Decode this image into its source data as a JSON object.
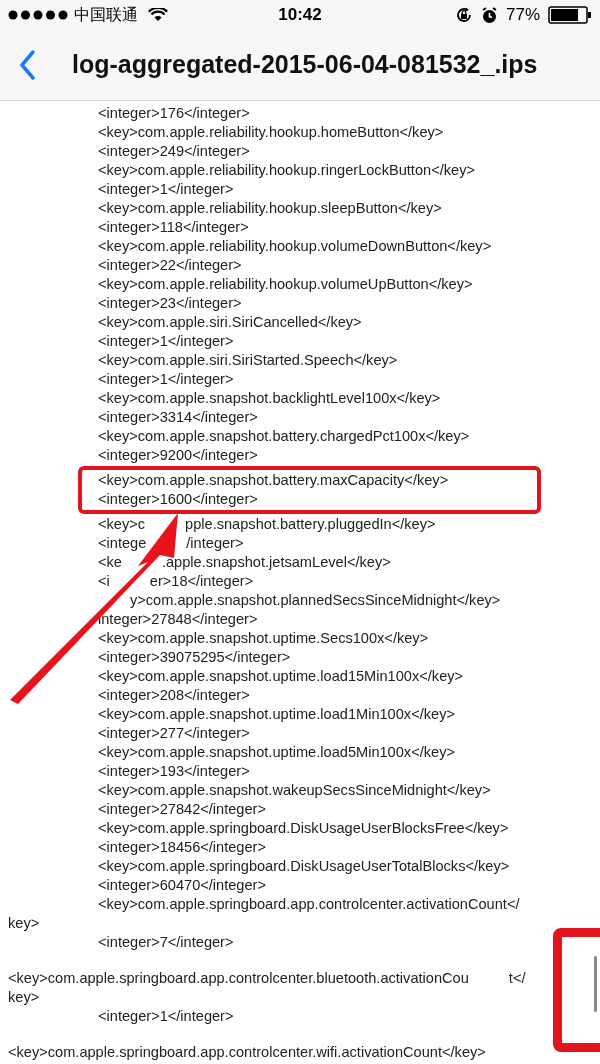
{
  "status_bar": {
    "carrier": "中国联通",
    "time": "10:42",
    "battery": "77%"
  },
  "nav": {
    "title": "log-aggregated-2015-06-04-081532_.ips"
  },
  "lines": [
    {
      "kind": "indented",
      "parts": [
        "<integer>176</integer>"
      ]
    },
    {
      "kind": "indented",
      "parts": [
        "<key>com.apple.reliability.hookup.homeButton</key>"
      ]
    },
    {
      "kind": "indented",
      "parts": [
        "<integer>249</integer>"
      ]
    },
    {
      "kind": "indented",
      "parts": [
        "<key>com.apple.reliability.hookup.ringerLockButton</key>"
      ]
    },
    {
      "kind": "indented",
      "parts": [
        "<integer>1</integer>"
      ]
    },
    {
      "kind": "indented",
      "parts": [
        "<key>com.apple.reliability.hookup.sleepButton</key>"
      ]
    },
    {
      "kind": "indented",
      "parts": [
        "<integer>118</integer>"
      ]
    },
    {
      "kind": "indented",
      "parts": [
        "<key>com.apple.reliability.hookup.volumeDownButton</key>"
      ]
    },
    {
      "kind": "indented",
      "parts": [
        "<integer>22</integer>"
      ]
    },
    {
      "kind": "indented",
      "parts": [
        "<key>com.apple.reliability.hookup.volumeUpButton</key>"
      ]
    },
    {
      "kind": "indented",
      "parts": [
        "<integer>23</integer>"
      ]
    },
    {
      "kind": "indented",
      "parts": [
        "<key>com.apple.siri.SiriCancelled</key>"
      ]
    },
    {
      "kind": "indented",
      "parts": [
        "<integer>1</integer>"
      ]
    },
    {
      "kind": "indented",
      "parts": [
        "<key>com.apple.siri.SiriStarted.Speech</key>"
      ]
    },
    {
      "kind": "indented",
      "parts": [
        "<integer>1</integer>"
      ]
    },
    {
      "kind": "indented",
      "parts": [
        "<key>com.apple.snapshot.backlightLevel100x</key>"
      ]
    },
    {
      "kind": "indented",
      "parts": [
        "<integer>3314</integer>"
      ]
    },
    {
      "kind": "indented",
      "parts": [
        "<key>com.apple.snapshot.battery.chargedPct100x</key>"
      ]
    },
    {
      "kind": "indented",
      "parts": [
        "<integer>9200</integer>"
      ]
    },
    {
      "kind": "highlighted",
      "parts": [
        "<key>com.apple.snapshot.battery.maxCapacity</key>"
      ]
    },
    {
      "kind": "highlighted",
      "parts": [
        "<integer>1600</integer>"
      ]
    },
    {
      "kind": "indented",
      "parts": [
        "<key>c",
        "pple.snapshot.battery.pluggedIn</key>"
      ]
    },
    {
      "kind": "indented",
      "parts": [
        "<intege",
        "/integer>"
      ]
    },
    {
      "kind": "indented",
      "parts": [
        "<ke",
        ".apple.snapshot.jetsamLevel</key>"
      ]
    },
    {
      "kind": "indented",
      "parts": [
        "<i",
        "er>18</integer>"
      ]
    },
    {
      "kind": "covered",
      "parts": [
        "y>com.apple.snapshot.plannedSecsSinceMidnight</key>"
      ]
    },
    {
      "kind": "indented",
      "parts": [
        "integer>27848</integer>"
      ]
    },
    {
      "kind": "indented",
      "parts": [
        "<key>com.apple.snapshot.uptime.Secs100x</key>"
      ]
    },
    {
      "kind": "indented",
      "parts": [
        "<integer>39075295</integer>"
      ]
    },
    {
      "kind": "indented",
      "parts": [
        "<key>com.apple.snapshot.uptime.load15Min100x</key>"
      ]
    },
    {
      "kind": "indented",
      "parts": [
        "<integer>208</integer>"
      ]
    },
    {
      "kind": "indented",
      "parts": [
        "<key>com.apple.snapshot.uptime.load1Min100x</key>"
      ]
    },
    {
      "kind": "indented",
      "parts": [
        "<integer>277</integer>"
      ]
    },
    {
      "kind": "indented",
      "parts": [
        "<key>com.apple.snapshot.uptime.load5Min100x</key>"
      ]
    },
    {
      "kind": "indented",
      "parts": [
        "<integer>193</integer>"
      ]
    },
    {
      "kind": "indented",
      "parts": [
        "<key>com.apple.snapshot.wakeupSecsSinceMidnight</key>"
      ]
    },
    {
      "kind": "indented",
      "parts": [
        "<integer>27842</integer>"
      ]
    },
    {
      "kind": "indented",
      "parts": [
        "<key>com.apple.springboard.DiskUsageUserBlocksFree</key>"
      ]
    },
    {
      "kind": "indented",
      "parts": [
        "<integer>18456</integer>"
      ]
    },
    {
      "kind": "indented",
      "parts": [
        "<key>com.apple.springboard.DiskUsageUserTotalBlocks</key>"
      ]
    },
    {
      "kind": "indented",
      "parts": [
        "<integer>60470</integer>"
      ]
    },
    {
      "kind": "indented",
      "parts": [
        "<key>com.apple.springboard.app.controlcenter.activationCount</"
      ]
    },
    {
      "kind": "wrap",
      "parts": [
        "key>"
      ]
    },
    {
      "kind": "indented",
      "parts": [
        "<integer>7</integer>"
      ]
    },
    {
      "kind": "flush",
      "parts": [
        "<key>com.apple.springboard.app.controlcenter.bluetooth.activationCou",
        "t</"
      ]
    },
    {
      "kind": "wrap",
      "parts": [
        "key>"
      ]
    },
    {
      "kind": "indented",
      "parts": [
        "<integer>1</integer>"
      ]
    },
    {
      "kind": "flush",
      "parts": [
        "<key>com.apple.springboard.app.controlcenter.wifi.activationCount</key>"
      ]
    }
  ]
}
